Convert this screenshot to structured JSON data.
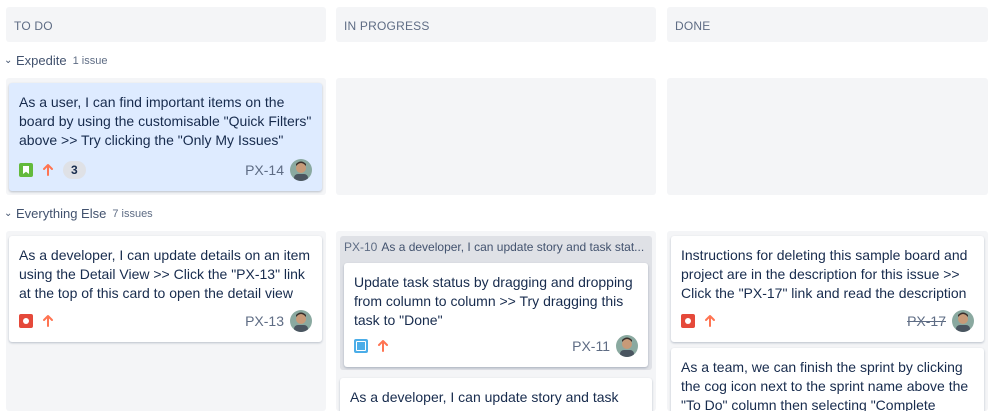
{
  "columns": [
    {
      "label": "TO DO"
    },
    {
      "label": "IN PROGRESS"
    },
    {
      "label": "DONE"
    }
  ],
  "swimlanes": [
    {
      "label": "Expedite",
      "count": "1 issue"
    },
    {
      "label": "Everything Else",
      "count": "7 issues"
    }
  ],
  "cards": {
    "px14": {
      "summary": "As a user, I can find important items on the board by using the customisable \"Quick Filters\" above >> Try clicking the \"Only My Issues\"",
      "key": "PX-14",
      "badge": "3",
      "type_icon": "story-icon",
      "priority_icon": "priority-high-icon"
    },
    "px13": {
      "summary": "As a developer, I can update details on an item using the Detail View >> Click the \"PX-13\" link at the top of this card to open the detail view",
      "key": "PX-13",
      "type_icon": "bug-icon",
      "priority_icon": "priority-high-icon"
    },
    "px10_parent": {
      "key": "PX-10",
      "summary": "As a developer, I can update story and task stat..."
    },
    "px11": {
      "summary": "Update task status by dragging and dropping from column to column >> Try dragging this task to \"Done\"",
      "key": "PX-11",
      "type_icon": "subtask-icon",
      "priority_icon": "priority-high-icon"
    },
    "px10_partial": {
      "summary": "As a developer, I can update story and task"
    },
    "px17": {
      "summary": "Instructions for deleting this sample board and project are in the description for this issue >> Click the \"PX-17\" link and read the description",
      "key": "PX-17",
      "type_icon": "bug-icon",
      "priority_icon": "priority-high-icon"
    },
    "done2": {
      "summary": "As a team, we can finish the sprint by clicking the cog icon next to the sprint name above the \"To Do\" column then selecting \"Complete"
    }
  },
  "colors": {
    "selected_card": "#deebff",
    "lane_bg": "#f4f5f7",
    "priority_high": "#ff7452"
  }
}
